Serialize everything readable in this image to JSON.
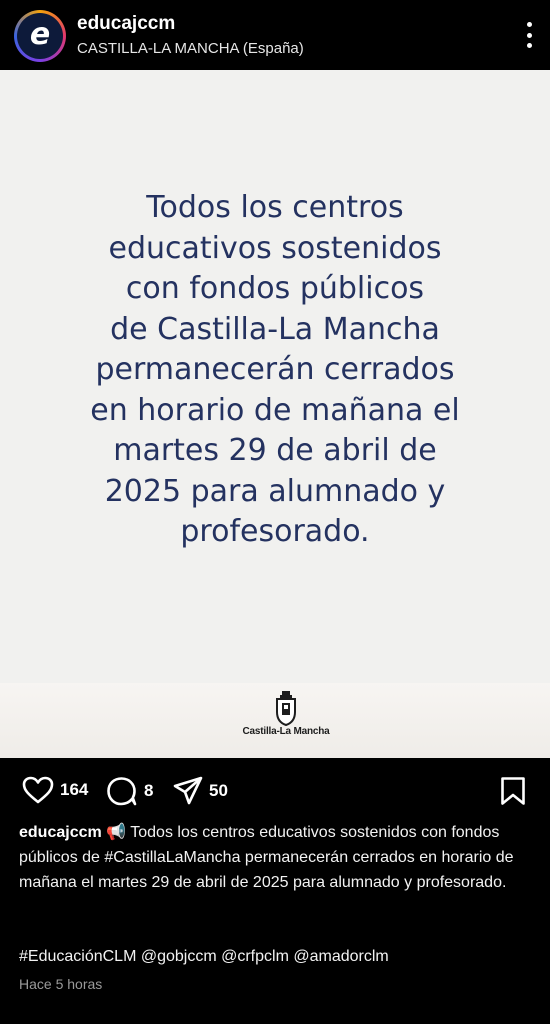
{
  "header": {
    "username": "educajccm",
    "location": "CASTILLA-LA MANCHA (España)",
    "avatar_letter": "e",
    "more_icon": "more-vertical-icon"
  },
  "post": {
    "lines": [
      "Todos los centros",
      "educativos sostenidos",
      "con fondos públicos",
      "de Castilla-La Mancha",
      "permanecerán cerrados",
      "en horario de mañana el",
      "martes 29 de abril de",
      "2025 para alumnado y",
      "profesorado."
    ],
    "logo_label": "Castilla-La Mancha",
    "logo_icon": "coat-of-arms-icon",
    "text_color": "#243260",
    "background": "#f1f1ef"
  },
  "actions": {
    "likes": "164",
    "comments": "8",
    "shares": "50",
    "icons": [
      "heart-icon",
      "comment-icon",
      "share-icon",
      "bookmark-icon"
    ]
  },
  "caption": {
    "user": "educajccm",
    "emoji": "📢",
    "text": " Todos los centros educativos sostenidos con fondos públicos de #CastillaLaMancha permanecerán cerrados en horario de mañana el martes 29 de abril de 2025 para alumnado y profesorado.",
    "hashtags": "#EducaciónCLM @gobjccm @crfpclm @amadorclm",
    "time": "Hace 5 horas"
  }
}
